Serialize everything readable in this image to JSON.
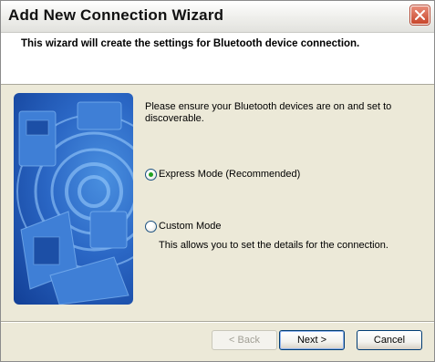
{
  "window": {
    "title": "Add New Connection Wizard",
    "close_icon": "close-icon"
  },
  "header": {
    "text": "This wizard will create the settings for Bluetooth device connection."
  },
  "main": {
    "intro": "Please ensure your Bluetooth devices are on and set to discoverable.",
    "options": [
      {
        "label": "Express Mode (Recommended)",
        "selected": true
      },
      {
        "label": "Custom Mode",
        "selected": false,
        "description": "This allows you to set the details for the connection."
      }
    ]
  },
  "buttons": {
    "back": "< Back",
    "next": "Next >",
    "cancel": "Cancel"
  },
  "colors": {
    "illustration": "#2a66c4",
    "radio_dot": "#21a121",
    "close": "#c8462b"
  }
}
